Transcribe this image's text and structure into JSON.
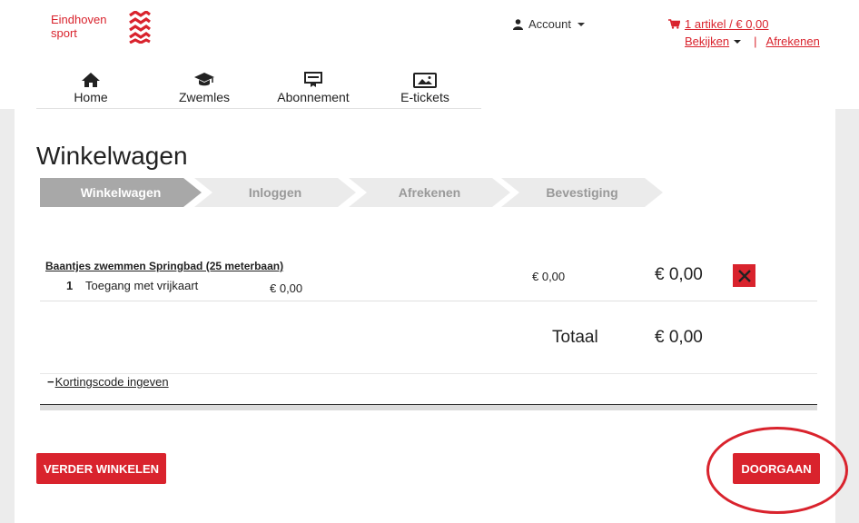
{
  "brand": {
    "line1": "Eindhoven",
    "line2": "sport",
    "accent": "#d9232d"
  },
  "account": {
    "label": "Account",
    "icon": "user-icon"
  },
  "cart": {
    "summary": "1 artikel / € 0,00",
    "view_label": "Bekijken",
    "separator": "|",
    "checkout_label": "Afrekenen",
    "icon": "shopping-cart-icon"
  },
  "nav": [
    {
      "label": "Home",
      "icon": "home-icon"
    },
    {
      "label": "Zwemles",
      "icon": "graduation-cap-icon"
    },
    {
      "label": "Abonnement",
      "icon": "membership-card-icon"
    },
    {
      "label": "E-tickets",
      "icon": "image-ticket-icon"
    }
  ],
  "page": {
    "title": "Winkelwagen"
  },
  "steps": [
    {
      "label": "Winkelwagen",
      "active": true
    },
    {
      "label": "Inloggen",
      "active": false
    },
    {
      "label": "Afrekenen",
      "active": false
    },
    {
      "label": "Bevestiging",
      "active": false
    }
  ],
  "cart_item": {
    "title": "Baantjes zwemmen Springbad (25 meterbaan)",
    "quantity": "1",
    "description": "Toegang met vrijkaart",
    "unit_price": "€ 0,00",
    "price": "€ 0,00",
    "line_total": "€ 0,00",
    "remove_icon": "close-icon"
  },
  "totals": {
    "label": "Totaal",
    "value": "€ 0,00"
  },
  "discount": {
    "toggle": "−",
    "label": "Kortingscode ingeven"
  },
  "actions": {
    "continue_shopping": "VERDER WINKELEN",
    "proceed": "DOORGAAN"
  }
}
